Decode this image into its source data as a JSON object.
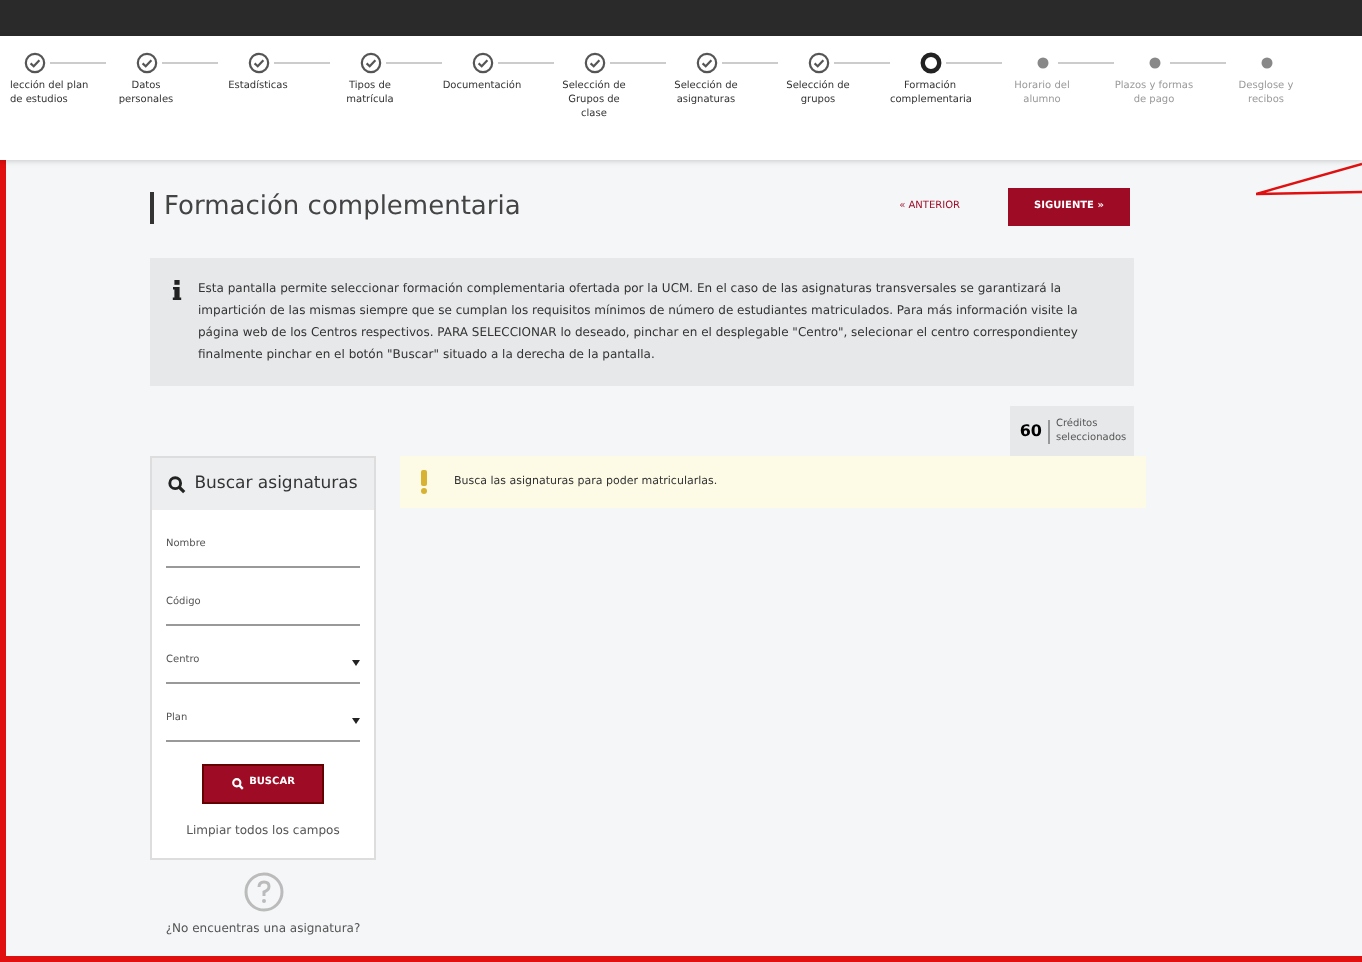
{
  "steps": [
    {
      "label": "lección del plan de estudios",
      "completed": true,
      "selected": false
    },
    {
      "label": "Datos personales",
      "completed": true,
      "selected": false
    },
    {
      "label": "Estadísticas",
      "completed": true,
      "selected": false
    },
    {
      "label": "Tipos de matrícula",
      "completed": true,
      "selected": false
    },
    {
      "label": "Documentación",
      "completed": true,
      "selected": false
    },
    {
      "label": "Selección de Grupos de clase",
      "completed": true,
      "selected": false
    },
    {
      "label": "Selección de asignaturas",
      "completed": true,
      "selected": false
    },
    {
      "label": "Selección de grupos",
      "completed": true,
      "selected": false
    },
    {
      "label": "Formación complementaria",
      "completed": false,
      "selected": true
    },
    {
      "label": "Horario del alumno",
      "completed": false,
      "selected": false
    },
    {
      "label": "Plazos y formas de pago",
      "completed": false,
      "selected": false
    },
    {
      "label": "Desglose y recibos",
      "completed": false,
      "selected": false
    }
  ],
  "page_title": "Formación complementaria",
  "prev_link": "« ANTERIOR",
  "next_button": "SIGUIENTE »",
  "info_text": "Esta pantalla permite seleccionar formación complementaria ofertada por la UCM. En el caso de las asignaturas transversales se garantizará la impartición de las mismas siempre que se cumplan los requisitos mínimos de número de estudiantes matriculados. Para más información visite la página web de los Centros respectivos. PARA SELECCIONAR lo deseado, pinchar en el desplegable \"Centro\", selecionar el centro correspondientey finalmente pinchar en el botón \"Buscar\" situado a la derecha de la pantalla.",
  "credits": {
    "value": "60",
    "label": "Créditos seleccionados"
  },
  "search_panel": {
    "title": "Buscar asignaturas",
    "fields": [
      {
        "kind": "text",
        "placeholder": "Nombre"
      },
      {
        "kind": "text",
        "placeholder": "Código"
      },
      {
        "kind": "select",
        "placeholder": "Centro"
      },
      {
        "kind": "select",
        "placeholder": "Plan"
      }
    ],
    "search_button": "BUSCAR",
    "clear_link": "Limpiar todos los campos"
  },
  "help_link": "¿No encuentras una asignatura?",
  "warning": "Busca las asignaturas para poder matricularlas."
}
